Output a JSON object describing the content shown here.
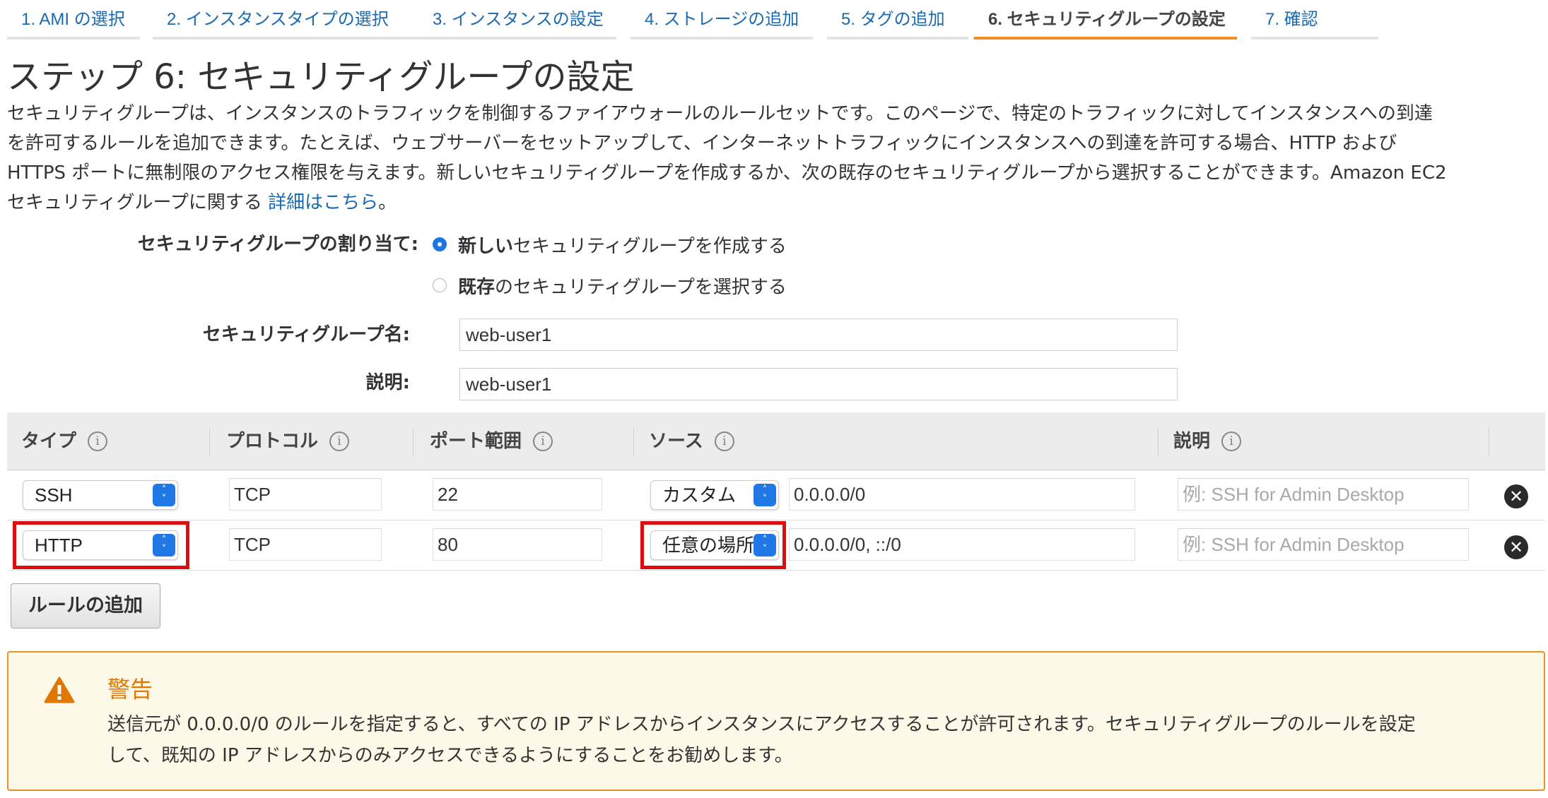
{
  "wizard_tabs": [
    {
      "label": "1. AMI の選択"
    },
    {
      "label": "2. インスタンスタイプの選択"
    },
    {
      "label": "3. インスタンスの設定"
    },
    {
      "label": "4. ストレージの追加"
    },
    {
      "label": "5. タグの追加"
    },
    {
      "label": "6. セキュリティグループの設定",
      "active": true
    },
    {
      "label": "7. 確認"
    }
  ],
  "page": {
    "title": "ステップ 6: セキュリティグループの設定",
    "description_lines": [
      "セキュリティグループは、インスタンスのトラフィックを制御するファイアウォールのルールセットです。このページで、特定のトラフィックに対してインスタンスへの到達",
      "を許可するルールを追加できます。たとえば、ウェブサーバーをセットアップして、インターネットトラフィックにインスタンスへの到達を許可する場合、HTTP および",
      "HTTPS ポートに無制限のアクセス権限を与えます。新しいセキュリティグループを作成するか、次の既存のセキュリティグループから選択することができます。Amazon EC2",
      "セキュリティグループに関する "
    ],
    "details_link": "詳細はこちら",
    "description_end": "。"
  },
  "assignment": {
    "label": "セキュリティグループの割り当て:",
    "option_new_bold": "新しい",
    "option_new_rest": "セキュリティグループを作成する",
    "option_existing_bold": "既存",
    "option_existing_rest": "のセキュリティグループを選択する",
    "selected": "new"
  },
  "group_name": {
    "label": "セキュリティグループ名:",
    "value": "web-user1"
  },
  "group_description": {
    "label": "説明:",
    "value": "web-user1"
  },
  "table": {
    "headers": {
      "type": "タイプ",
      "protocol": "プロトコル",
      "port_range": "ポート範囲",
      "source": "ソース",
      "description": "説明"
    },
    "info_glyph": "i",
    "rows": [
      {
        "type": "SSH",
        "protocol": "TCP",
        "port": "22",
        "source_mode": "カスタム",
        "source": "0.0.0.0/0",
        "description_placeholder": "例: SSH for Admin Desktop"
      },
      {
        "type": "HTTP",
        "protocol": "TCP",
        "port": "80",
        "source_mode": "任意の場所",
        "source": "0.0.0.0/0, ::/0",
        "description_placeholder": "例: SSH for Admin Desktop"
      }
    ]
  },
  "add_rule_button": "ルールの追加",
  "warning": {
    "title": "警告",
    "lines": [
      "送信元が 0.0.0.0/0 のルールを指定すると、すべての IP アドレスからインスタンスにアクセスすることが許可されます。セキュリティグループのルールを設定",
      "して、既知の IP アドレスからのみアクセスできるようにすることをお勧めします。"
    ]
  },
  "colors": {
    "link": "#1a6ab2",
    "active_tab_underline": "#f48b24",
    "highlight_border": "#dd0e0e",
    "warning_border": "#e69424",
    "warning_title": "#e07700",
    "select_chevron": "#1f78e6"
  },
  "icons": {
    "info": "info-circle-icon",
    "remove": "remove-circle-icon",
    "warning": "warning-triangle-icon",
    "select": "chevron-updown-icon"
  }
}
